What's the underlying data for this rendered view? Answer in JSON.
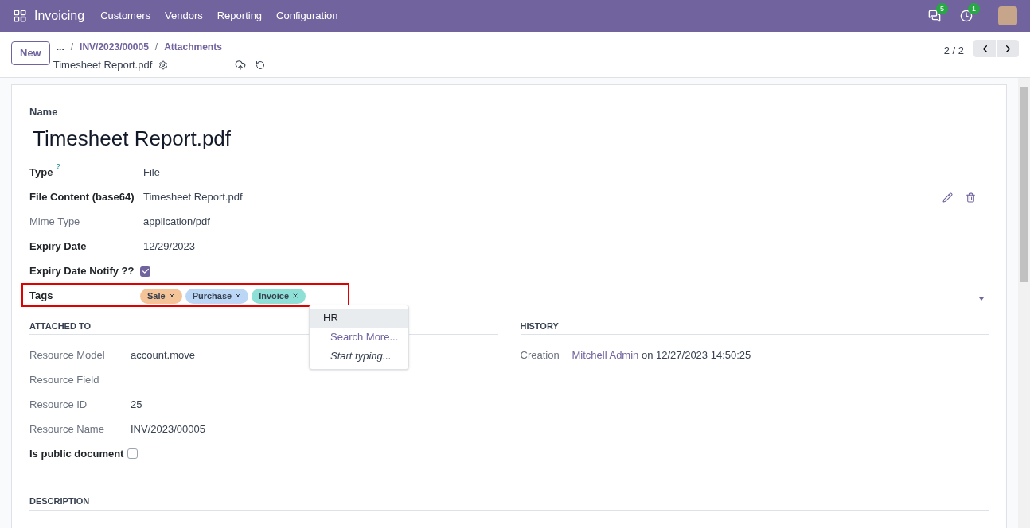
{
  "navbar": {
    "app": "Invoicing",
    "menu": [
      "Customers",
      "Vendors",
      "Reporting",
      "Configuration"
    ],
    "messages_count": "5",
    "activities_count": "1"
  },
  "control_panel": {
    "new_button": "New",
    "breadcrumb_more": "...",
    "breadcrumbs": [
      {
        "separator": "/",
        "label": "INV/2023/00005"
      },
      {
        "separator": "/",
        "label": "Attachments"
      }
    ],
    "record_title": "Timesheet Report.pdf",
    "pager": "2 / 2"
  },
  "form": {
    "name_label": "Name",
    "name": "Timesheet Report.pdf",
    "fields": [
      {
        "kind": "text",
        "label": "Type",
        "bold": true,
        "help": "?",
        "value": "File"
      },
      {
        "kind": "binary",
        "label": "File Content (base64)",
        "bold": true,
        "value": "Timesheet Report.pdf"
      },
      {
        "kind": "text",
        "label": "Mime Type",
        "bold": false,
        "value": "application/pdf"
      },
      {
        "kind": "text",
        "label": "Expiry Date",
        "bold": true,
        "value": "12/29/2023"
      },
      {
        "kind": "checkbox",
        "label": "Expiry Date Notify ??",
        "bold": true,
        "checked": true
      },
      {
        "kind": "tags",
        "label": "Tags",
        "bold": true,
        "tags": [
          {
            "label": "Sale",
            "color": "#f4c397"
          },
          {
            "label": "Purchase",
            "color": "#bcd7f5"
          },
          {
            "label": "Invoice",
            "color": "#8ee0d6"
          }
        ]
      }
    ],
    "tag_dropdown": [
      {
        "label": "HR",
        "kind": "option",
        "selected": true
      },
      {
        "label": "Search More...",
        "kind": "link",
        "selected": false
      },
      {
        "label": "Start typing...",
        "kind": "hint",
        "selected": false
      }
    ],
    "attached_to": {
      "title": "ATTACHED TO",
      "fields": [
        {
          "kind": "text",
          "label": "Resource Model",
          "bold": false,
          "value": "account.move"
        },
        {
          "kind": "text",
          "label": "Resource Field",
          "bold": false
        },
        {
          "kind": "text",
          "label": "Resource ID",
          "bold": false,
          "value": "25"
        },
        {
          "kind": "text",
          "label": "Resource Name",
          "bold": false,
          "value": "INV/2023/00005"
        },
        {
          "kind": "checkbox",
          "label": "Is public document",
          "bold": true,
          "checked": false
        }
      ]
    },
    "history": {
      "title": "HISTORY",
      "label": "Creation",
      "user": "Mitchell Admin",
      "rest": "on 12/27/2023 14:50:25"
    },
    "description_title": "DESCRIPTION"
  }
}
